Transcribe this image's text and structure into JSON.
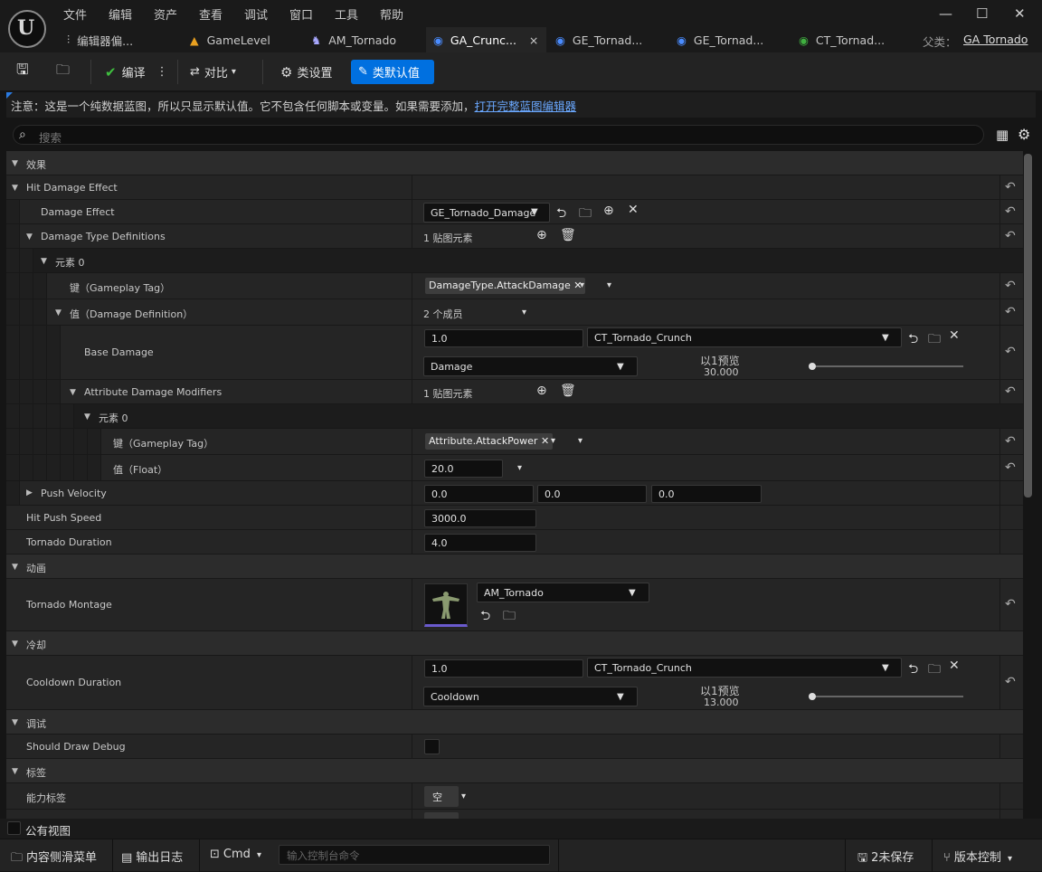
{
  "menu": [
    "文件",
    "编辑",
    "资产",
    "查看",
    "调试",
    "窗口",
    "工具",
    "帮助"
  ],
  "tabs": [
    {
      "label": "编辑器偏...",
      "icon": "sliders-icon"
    },
    {
      "label": "GameLevel",
      "icon": "level-icon"
    },
    {
      "label": "AM_Tornado",
      "icon": "montage-icon"
    },
    {
      "label": "GA_Crunc...",
      "icon": "blueprint-icon",
      "close": "×"
    },
    {
      "label": "GE_Tornad...",
      "icon": "blueprint-icon"
    },
    {
      "label": "GE_Tornad...",
      "icon": "blueprint-icon"
    },
    {
      "label": "CT_Tornad...",
      "icon": "curvetable-icon"
    }
  ],
  "parent": {
    "label": "父类：",
    "value": "GA Tornado"
  },
  "toolbar": {
    "compile": "编译",
    "diff": "对比",
    "class_settings": "类设置",
    "class_defaults": "类默认值"
  },
  "notice": {
    "text": "注意：这是一个纯数据蓝图，所以只显示默认值。它不包含任何脚本或变量。如果需要添加，",
    "link": "打开完整蓝图编辑器"
  },
  "search": {
    "placeholder": "搜索"
  },
  "sections": {
    "effects": "效果",
    "animation": "动画",
    "cooldown": "冷却",
    "debug": "调试",
    "tags": "标签"
  },
  "props": {
    "hit_damage_effect": "Hit Damage Effect",
    "damage_effect": "Damage Effect",
    "damage_effect_value": "GE_Tornado_Damage",
    "damage_type_defs": "Damage Type Definitions",
    "map_elements": "1 贴图元素",
    "element0": "元素 0",
    "key_gameplay_tag": "键（Gameplay Tag）",
    "damage_type_tag": "DamageType.AttackDamage",
    "value_damage_def": "值（Damage Definition）",
    "members": "2 个成员",
    "base_damage": "Base Damage",
    "base_damage_value": "1.0",
    "curve_table": "CT_Tornado_Crunch",
    "damage_row": "Damage",
    "preview_label": "以1预览",
    "damage_preview": "30.000",
    "attr_mods": "Attribute Damage Modifiers",
    "attr_map_elements": "1 贴图元素",
    "attr_element0": "元素 0",
    "attr_key": "键（Gameplay Tag）",
    "attr_tag": "Attribute.AttackPower",
    "attr_value_label": "值（Float）",
    "attr_value": "20.0",
    "push_velocity": "Push Velocity",
    "push_x": "0.0",
    "push_y": "0.0",
    "push_z": "0.0",
    "hit_push_speed": "Hit Push Speed",
    "hit_push_speed_value": "3000.0",
    "tornado_duration": "Tornado Duration",
    "tornado_duration_value": "4.0",
    "tornado_montage": "Tornado Montage",
    "montage_value": "AM_Tornado",
    "cooldown_duration": "Cooldown Duration",
    "cooldown_value": "1.0",
    "cooldown_curve": "CT_Tornado_Crunch",
    "cooldown_row": "Cooldown",
    "cooldown_preview_label": "以1预览",
    "cooldown_preview": "13.000",
    "should_draw_debug": "Should Draw Debug",
    "ability_tags": "能力标签",
    "ability_tags_value": "空"
  },
  "public_view": "公有视图",
  "status": {
    "content_drawer": "内容侧滑菜单",
    "output_log": "输出日志",
    "cmd": "Cmd",
    "console_placeholder": "输入控制台命令",
    "unsaved": "2未保存",
    "source_control": "版本控制"
  },
  "colors": {
    "accent": "#0070e0",
    "link": "#6aa8ff",
    "bg": "#151515"
  }
}
